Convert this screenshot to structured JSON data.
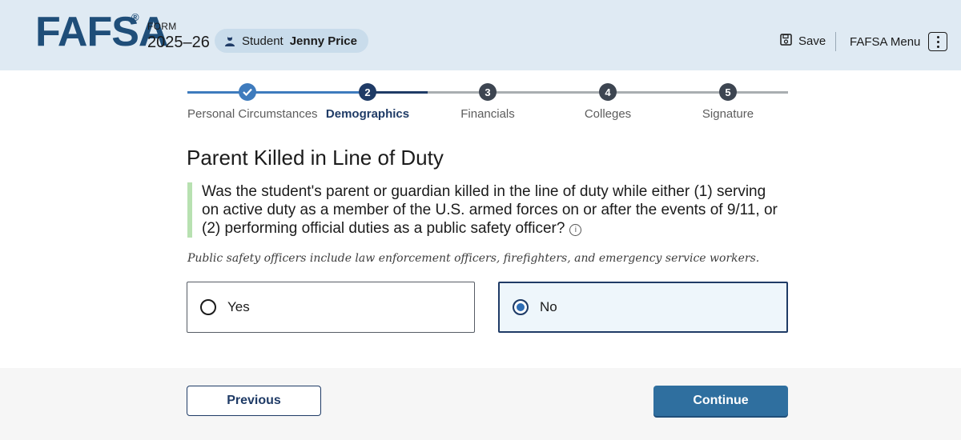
{
  "header": {
    "logo": "FAFSA",
    "logo_mark": "®",
    "form_label": "FORM",
    "form_year": "2025–26",
    "student_prefix": "Student",
    "student_name": "Jenny Price",
    "save_label": "Save",
    "menu_label": "FAFSA Menu",
    "icons": {
      "student": "student-icon",
      "save": "save-icon",
      "menu": "kebab-menu-icon"
    }
  },
  "stepper": {
    "current_step": 2,
    "steps": [
      {
        "number": "1",
        "label": "Personal Circumstances",
        "status": "complete"
      },
      {
        "number": "2",
        "label": "Demographics",
        "status": "current"
      },
      {
        "number": "3",
        "label": "Financials",
        "status": "upcoming"
      },
      {
        "number": "4",
        "label": "Colleges",
        "status": "upcoming"
      },
      {
        "number": "5",
        "label": "Signature",
        "status": "upcoming"
      }
    ],
    "colors": {
      "complete": "#3e7bbd",
      "current": "#1f3b66",
      "upcoming": "#565c65",
      "track": "#a9aeb1"
    }
  },
  "main": {
    "title": "Parent Killed in Line of Duty",
    "question": "Was the student's parent or guardian killed in the line of duty while either (1) serving on active duty as a member of the U.S. armed forces on or after the events of 9/11, or (2) performing official duties as a public safety officer?",
    "info_icon": "info-icon",
    "hint": "Public safety officers include law enforcement officers, firefighters, and emergency service workers.",
    "options": [
      {
        "label": "Yes",
        "selected": false
      },
      {
        "label": "No",
        "selected": true
      }
    ]
  },
  "footer": {
    "previous_label": "Previous",
    "continue_label": "Continue"
  }
}
